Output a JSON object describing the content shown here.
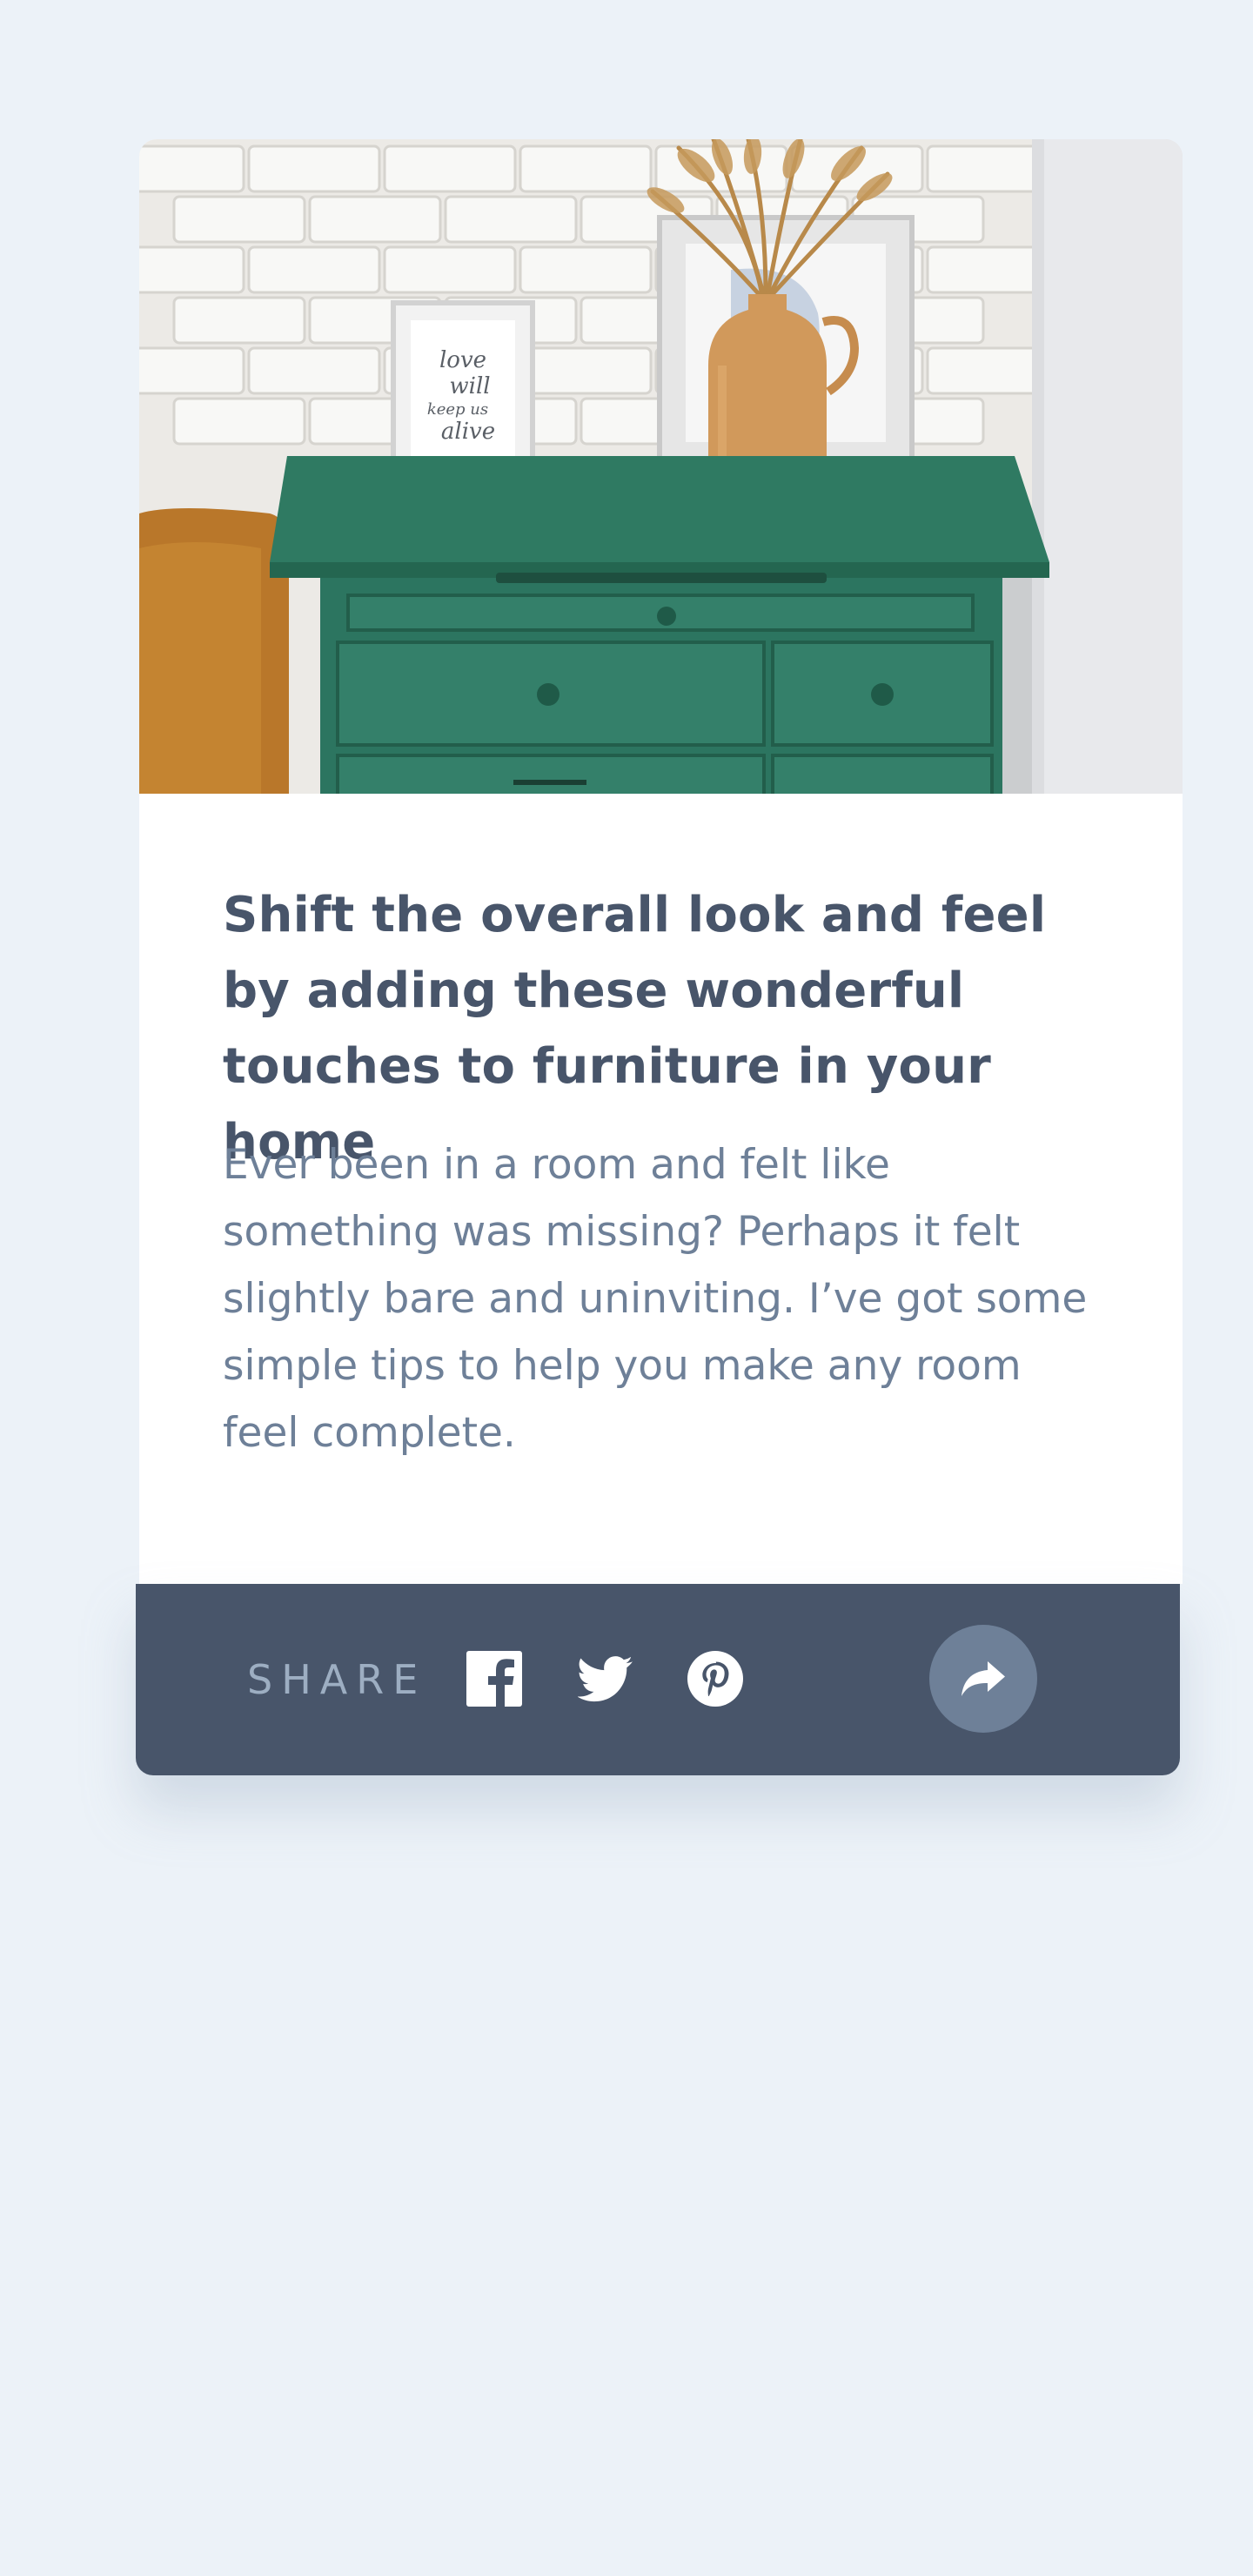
{
  "article": {
    "title": "Shift the overall look and feel by adding these wonderful touches to furniture in your home",
    "excerpt": "Ever been in a room and felt like something was missing? Perhaps it felt slightly bare and uninviting. I’ve got some simple tips to help you make any room feel complete.",
    "image_frame_text": "love will keep us alive"
  },
  "share": {
    "label": "SHARE",
    "icons": [
      "facebook-icon",
      "twitter-icon",
      "pinterest-icon",
      "share-arrow-icon"
    ]
  },
  "colors": {
    "page_background": "#ecf2f8",
    "card_background": "#ffffff",
    "title": "#48556a",
    "body_text": "#6e8098",
    "share_bar": "#48556a",
    "share_label": "#9daec2",
    "share_button": "#6e8098",
    "dresser_green": "#2f7a62"
  }
}
